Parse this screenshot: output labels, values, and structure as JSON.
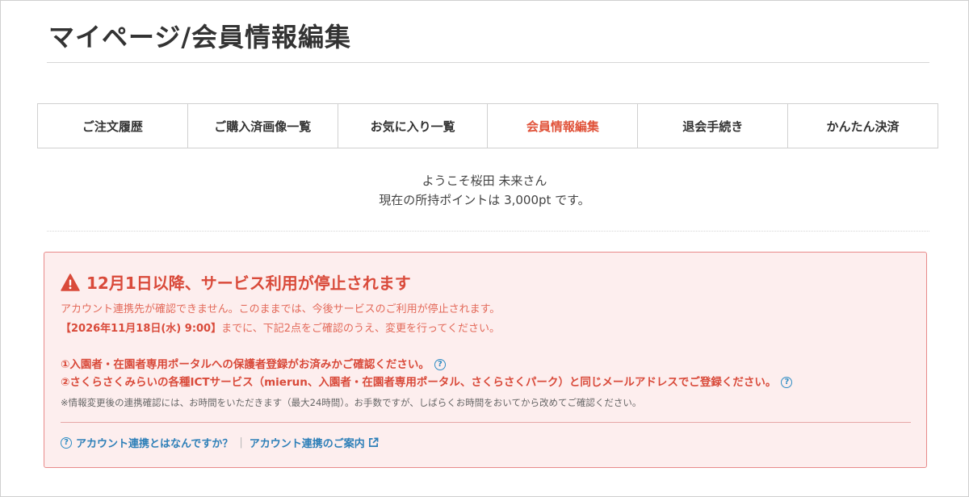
{
  "page_title": "マイページ/会員情報編集",
  "tabs": [
    {
      "label": "ご注文履歴"
    },
    {
      "label": "ご購入済画像一覧"
    },
    {
      "label": "お気に入り一覧"
    },
    {
      "label": "会員情報編集"
    },
    {
      "label": "退会手続き"
    },
    {
      "label": "かんたん決済"
    }
  ],
  "active_tab": "会員情報編集",
  "welcome": {
    "greeting": "ようこそ桜田 未来さん",
    "points": "現在の所持ポイントは 3,000pt です。"
  },
  "alert": {
    "title": "12月1日以降、サービス利用が停止されます",
    "line1": "アカウント連携先が確認できません。このままでは、今後サービスのご利用が停止されます。",
    "deadline": "【2026年11月18日(水) 9:00】",
    "line2_rest": "までに、下記2点をご確認のうえ、変更を行ってください。",
    "req1": "①入園者・在園者専用ポータルへの保護者登録がお済みかご確認ください。",
    "req2": "②さくらさくみらいの各種ICTサービス（mierun、入園者・在園者専用ポータル、さくらさくパーク）と同じメールアドレスでご登録ください。",
    "note": "※情報変更後の連携確認には、お時間をいただきます（最大24時間）。お手数ですが、しばらくお時間をおいてから改めてご確認ください。",
    "link1": "アカウント連携とはなんですか？",
    "separator": "|",
    "link2": "アカウント連携のご案内",
    "help_glyph": "?"
  },
  "colors": {
    "accent": "#e0533a",
    "alert_bg": "#fdeeee",
    "alert_border": "#e88a8a",
    "alert_text": "#d94a3a",
    "link": "#2d7fb8"
  },
  "icons": {
    "warning": "warning-triangle-icon",
    "help": "question-circle-icon",
    "external": "external-link-icon"
  }
}
